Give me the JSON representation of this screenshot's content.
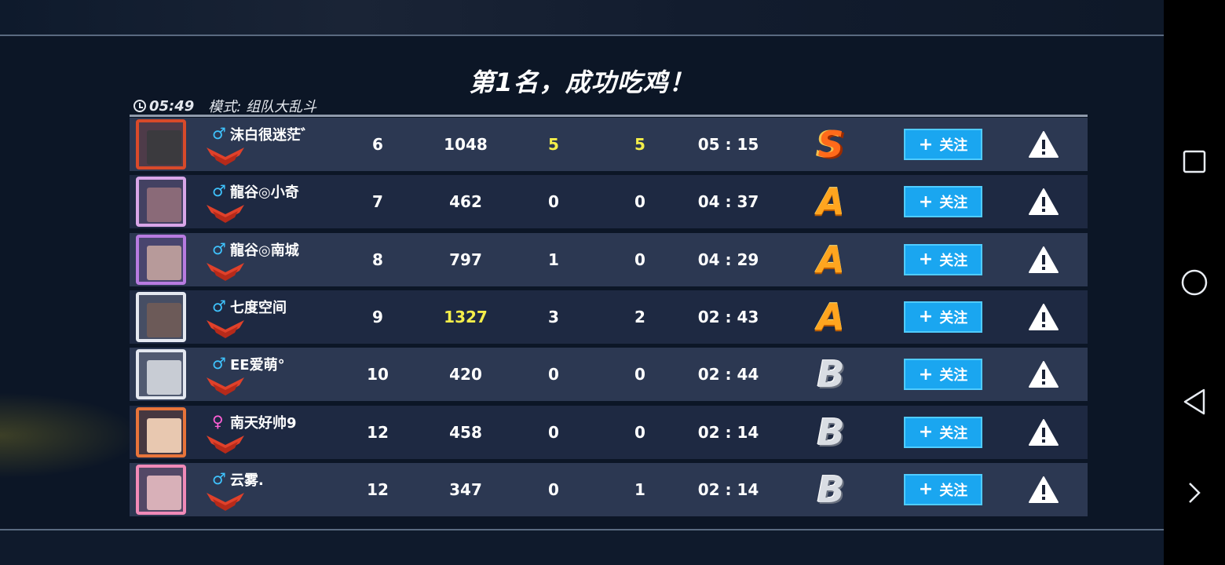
{
  "header": {
    "title": "第1名，成功吃鸡！",
    "time": "05:49",
    "mode": "模式: 组队大乱斗"
  },
  "follow_label": "关注",
  "colors": {
    "follow_button": "#1aa6f0",
    "row_odd": "#2c3852",
    "row_even": "#1e2942",
    "highlight": "#f4ee4a",
    "male": "#3fc4ff",
    "female": "#ff5fd6"
  },
  "players": [
    {
      "gender": "♂",
      "name": "沫白很迷茫゛",
      "level": "6",
      "score": "1048",
      "kills": "5",
      "assists": "5",
      "survival": "05 : 15",
      "grade": "S"
    },
    {
      "gender": "♂",
      "name": "龍谷◎小奇",
      "level": "7",
      "score": "462",
      "kills": "0",
      "assists": "0",
      "survival": "04 : 37",
      "grade": "A"
    },
    {
      "gender": "♂",
      "name": "龍谷◎南城",
      "level": "8",
      "score": "797",
      "kills": "1",
      "assists": "0",
      "survival": "04 : 29",
      "grade": "A"
    },
    {
      "gender": "♂",
      "name": "七度空间",
      "level": "9",
      "score": "1327",
      "kills": "3",
      "assists": "2",
      "survival": "02 : 43",
      "grade": "A"
    },
    {
      "gender": "♂",
      "name": "EE爱萌°",
      "level": "10",
      "score": "420",
      "kills": "0",
      "assists": "0",
      "survival": "02 : 44",
      "grade": "B"
    },
    {
      "gender": "♀",
      "name": "南天好帅9",
      "level": "12",
      "score": "458",
      "kills": "0",
      "assists": "0",
      "survival": "02 : 14",
      "grade": "B"
    },
    {
      "gender": "♂",
      "name": "云雾.",
      "level": "12",
      "score": "347",
      "kills": "0",
      "assists": "1",
      "survival": "02 : 14",
      "grade": "B"
    }
  ],
  "sidebar": {
    "close": "×",
    "icons": [
      "close-icon",
      "square-recents-icon",
      "circle-home-icon",
      "triangle-back-icon",
      "chevron-right-icon"
    ]
  }
}
